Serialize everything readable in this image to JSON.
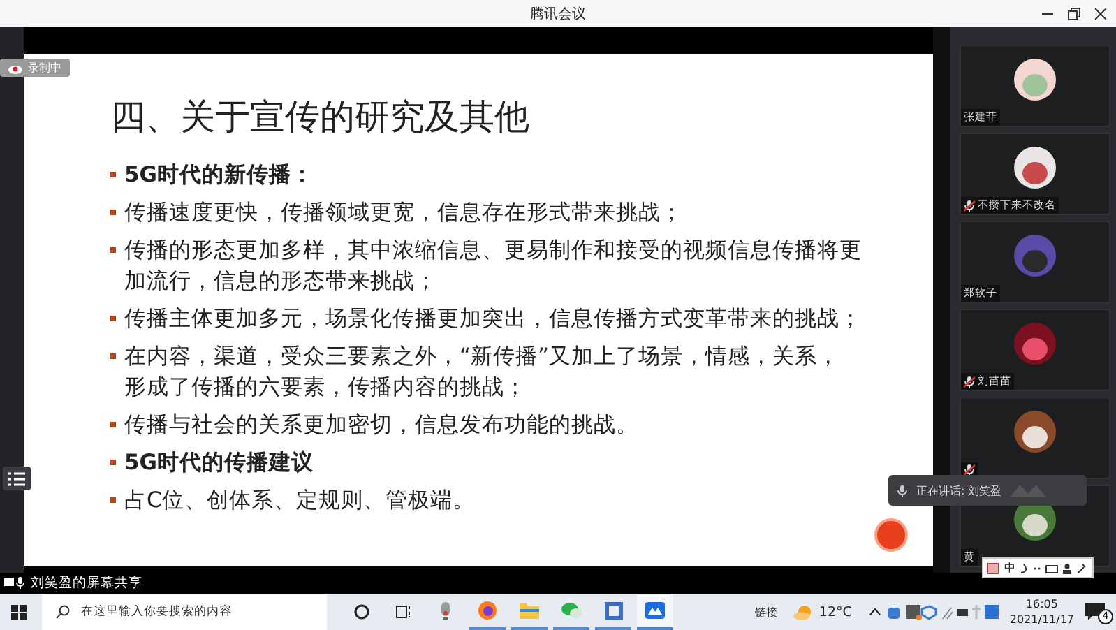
{
  "window": {
    "title": "腾讯会议"
  },
  "recording": {
    "label": "录制中"
  },
  "slide": {
    "title": "四、关于宣传的研究及其他",
    "bullets": [
      {
        "kind": "heading",
        "text": "5G时代的新传播："
      },
      {
        "kind": "item",
        "text": "传播速度更快，传播领域更宽，信息存在形式带来挑战；"
      },
      {
        "kind": "item",
        "text": "传播的形态更加多样，其中浓缩信息、更易制作和接受的视频信息传播将更加流行，信息的形态带来挑战；"
      },
      {
        "kind": "item",
        "text": "传播主体更加多元，场景化传播更加突出，信息传播方式变革带来的挑战；"
      },
      {
        "kind": "item",
        "text": "在内容，渠道，受众三要素之外，“新传播”又加上了场景，情感，关系，形成了传播的六要素，传播内容的挑战；"
      },
      {
        "kind": "item",
        "text": "传播与社会的关系更加密切，信息发布功能的挑战。"
      },
      {
        "kind": "heading",
        "text": "5G时代的传播建议"
      },
      {
        "kind": "item",
        "text": "占C位、创体系、定规则、管极端。"
      }
    ]
  },
  "participants": [
    {
      "name": "张建菲",
      "muted": false
    },
    {
      "name": "不攒下来不改名",
      "muted": true
    },
    {
      "name": "郑软子",
      "muted": false
    },
    {
      "name": "刘苗苗",
      "muted": true
    },
    {
      "muted": true
    },
    {
      "name": "黄",
      "muted": false
    }
  ],
  "speaking_toast": {
    "text": "正在讲话: 刘笑盈"
  },
  "ime_toolbar": {
    "mode": "中"
  },
  "share_label": "刘笑盈的屏幕共享",
  "taskbar": {
    "search": {
      "placeholder": "在这里输入你要搜索的内容"
    },
    "links_label": "链接",
    "temperature": "12°C",
    "time": "16:05",
    "date": "2021/11/17",
    "notification_count": "4"
  }
}
